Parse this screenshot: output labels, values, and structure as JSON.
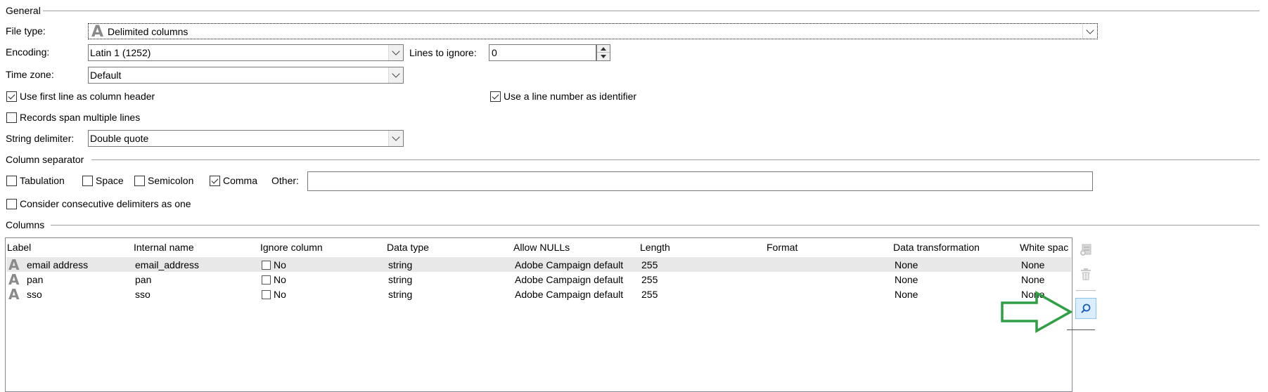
{
  "general": {
    "section_title": "General",
    "file_type_label": "File type:",
    "file_type_value": "Delimited columns",
    "file_type_icon": "text-type-A-icon",
    "encoding_label": "Encoding:",
    "encoding_value": "Latin 1 (1252)",
    "lines_to_ignore_label": "Lines to ignore:",
    "lines_to_ignore_value": "0",
    "time_zone_label": "Time zone:",
    "time_zone_value": "Default",
    "use_first_line_label": "Use first line as column header",
    "use_first_line_checked": true,
    "use_line_number_label": "Use a line number as identifier",
    "use_line_number_checked": true,
    "records_span_label": "Records span multiple lines",
    "records_span_checked": false,
    "string_delimiter_label": "String delimiter:",
    "string_delimiter_value": "Double quote"
  },
  "separator": {
    "section_title": "Column separator",
    "tabulation_label": "Tabulation",
    "tabulation_checked": false,
    "space_label": "Space",
    "space_checked": false,
    "semicolon_label": "Semicolon",
    "semicolon_checked": false,
    "comma_label": "Comma",
    "comma_checked": true,
    "other_label": "Other:",
    "other_value": "",
    "consecutive_label": "Consider consecutive delimiters as one",
    "consecutive_checked": false
  },
  "columns": {
    "section_title": "Columns",
    "headers": [
      "Label",
      "Internal name",
      "Ignore column",
      "Data type",
      "Allow NULLs",
      "Length",
      "Format",
      "Data transformation",
      "White spac"
    ],
    "rows": [
      {
        "label": "email address",
        "internal": "email_address",
        "ignore": "No",
        "type": "string",
        "nulls": "Adobe Campaign default",
        "length": "255",
        "format": "",
        "transform": "None",
        "white": "None"
      },
      {
        "label": "pan",
        "internal": "pan",
        "ignore": "No",
        "type": "string",
        "nulls": "Adobe Campaign default",
        "length": "255",
        "format": "",
        "transform": "None",
        "white": "None"
      },
      {
        "label": "sso",
        "internal": "sso",
        "ignore": "No",
        "type": "string",
        "nulls": "Adobe Campaign default",
        "length": "255",
        "format": "",
        "transform": "None",
        "white": "None"
      }
    ],
    "side_buttons": [
      "add-column-icon",
      "delete-icon",
      "search-icon"
    ]
  },
  "annotation": {
    "arrow_color": "#2ea043",
    "arrow_icon": "right-arrow-icon"
  }
}
